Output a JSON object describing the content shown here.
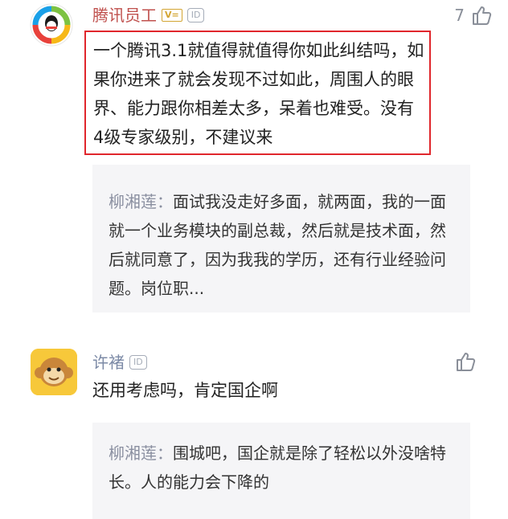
{
  "comments": [
    {
      "author": "腾讯员工",
      "badge_v": "V=",
      "badge_id": "ID",
      "likes": "7",
      "text": "一个腾讯3.1就值得就值得你如此纠结吗，如果你进来了就会发现不过如此，周围人的眼界、能力跟你相差太多，呆着也难受。没有4级专家级别，不建议来",
      "quote": {
        "name": "柳湘莲：",
        "text": "面试我没走好多面，就两面，我的一面就一个业务模块的副总裁，然后就是技术面，然后就同意了，因为我我的学历，还有行业经验问题。岗位职..."
      }
    },
    {
      "author": "许褚",
      "badge_id": "ID",
      "text": "还用考虑吗，肯定国企啊",
      "quote": {
        "name": "柳湘莲：",
        "text": "围城吧，国企就是除了轻松以外没啥特长。人的能力会下降的"
      }
    }
  ],
  "colors": {
    "highlight_border": "#e0262c",
    "author_name": "#c0514e",
    "quote_bg": "#f5f5f7"
  },
  "icons": [
    "tencent-qq-avatar",
    "monkey-avatar",
    "thumbs-up-icon"
  ]
}
